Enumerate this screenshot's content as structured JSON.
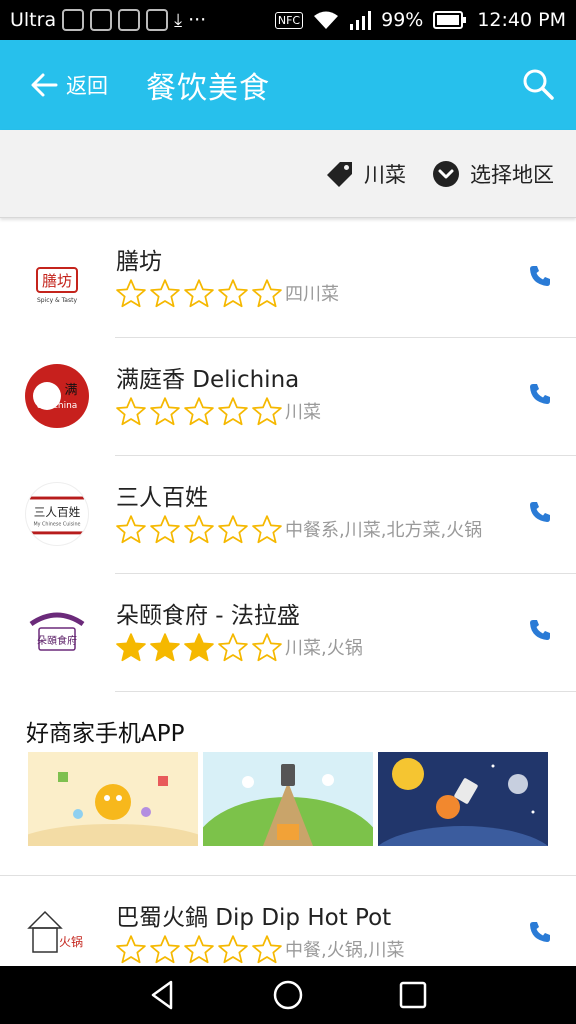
{
  "status_bar": {
    "carrier": "Ultra",
    "dots": "···",
    "nfc": "NFC",
    "battery": "99%",
    "time": "12:40 PM"
  },
  "header": {
    "back_label": "返回",
    "title": "餐饮美食",
    "accent_color": "#27c0ec"
  },
  "filters": {
    "category": "川菜",
    "region": "选择地区"
  },
  "restaurants": [
    {
      "name": "膳坊",
      "rating": 0,
      "tags": "四川菜",
      "logo_text": "膳坊",
      "logo_sub": "Spicy & Tasty"
    },
    {
      "name": "满庭香 Delichina",
      "rating": 0,
      "tags": "川菜",
      "logo_text": "delichina"
    },
    {
      "name": "三人百姓",
      "rating": 0,
      "tags": "中餐系,川菜,北方菜,火锅",
      "logo_text": "三人百姓",
      "logo_sub": "My Chinese Cuisine"
    },
    {
      "name": "朵颐食府 - 法拉盛",
      "rating": 3,
      "tags": "川菜,火锅",
      "logo_text": "朵頤食府"
    }
  ],
  "promo": {
    "title": "好商家手机APP",
    "images": [
      "promo-image-1",
      "promo-image-2",
      "promo-image-3"
    ]
  },
  "restaurants_after": [
    {
      "name": "巴蜀火鍋 Dip Dip Hot Pot",
      "rating": 0,
      "tags": "中餐,火锅,川菜",
      "logo_text": "火锅"
    }
  ],
  "colors": {
    "star_filled": "#f5b800",
    "star_empty": "#f5b800",
    "phone_icon": "#2a7bd6"
  }
}
